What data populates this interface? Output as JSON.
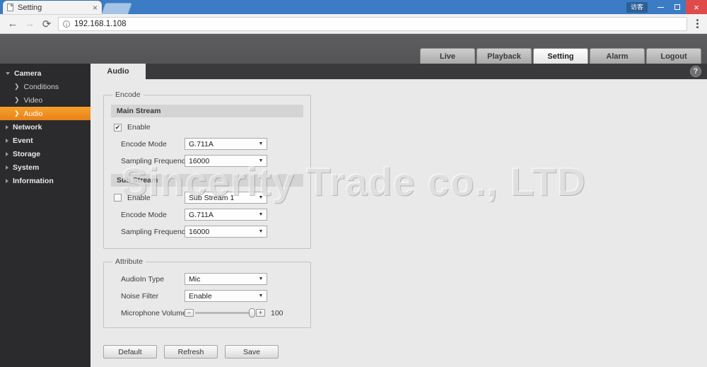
{
  "browser": {
    "tab_title": "Setting",
    "tab_close": "×",
    "back_icon": "←",
    "forward_icon": "→",
    "reload_icon": "⟳",
    "info_icon": "i",
    "url": "192.168.1.108",
    "menu_icon": "kebab-menu-icon",
    "guest_badge": "访客",
    "minimize_label": "–",
    "maximize_label": "□",
    "close_label": "×"
  },
  "app_header": {
    "brand_ghost": "",
    "nav_tabs": [
      {
        "label": "Live",
        "active": false
      },
      {
        "label": "Playback",
        "active": false
      },
      {
        "label": "Setting",
        "active": true
      },
      {
        "label": "Alarm",
        "active": false
      },
      {
        "label": "Logout",
        "active": false
      }
    ]
  },
  "sidebar": {
    "items": [
      {
        "label": "Camera",
        "level": "group",
        "expanded": true,
        "active": false
      },
      {
        "label": "Conditions",
        "level": "child",
        "active": false
      },
      {
        "label": "Video",
        "level": "child",
        "active": false
      },
      {
        "label": "Audio",
        "level": "child",
        "active": true
      },
      {
        "label": "Network",
        "level": "group",
        "expanded": false,
        "active": false
      },
      {
        "label": "Event",
        "level": "group",
        "expanded": false,
        "active": false
      },
      {
        "label": "Storage",
        "level": "group",
        "expanded": false,
        "active": false
      },
      {
        "label": "System",
        "level": "group",
        "expanded": false,
        "active": false
      },
      {
        "label": "Information",
        "level": "group",
        "expanded": false,
        "active": false
      }
    ]
  },
  "content": {
    "tab_label": "Audio",
    "help_label": "?",
    "encode": {
      "legend": "Encode",
      "main_stream": {
        "header": "Main Stream",
        "enable_label": "Enable",
        "enable_checked": true,
        "check_glyph": "✔",
        "encode_mode_label": "Encode Mode",
        "encode_mode_value": "G.711A",
        "sampling_label": "Sampling Frequency",
        "sampling_value": "16000"
      },
      "sub_stream": {
        "header": "Sub Stream",
        "enable_label": "Enable",
        "enable_checked": false,
        "check_glyph": "",
        "stream_select_value": "Sub Stream 1",
        "encode_mode_label": "Encode Mode",
        "encode_mode_value": "G.711A",
        "sampling_label": "Sampling Frequency",
        "sampling_value": "16000"
      }
    },
    "attribute": {
      "legend": "Attribute",
      "audioin_type_label": "AudioIn Type",
      "audioin_type_value": "Mic",
      "noise_filter_label": "Noise Filter",
      "noise_filter_value": "Enable",
      "mic_volume_label": "Microphone Volume",
      "mic_volume_value": "100",
      "minus_label": "−",
      "plus_label": "+"
    },
    "buttons": [
      {
        "label": "Default"
      },
      {
        "label": "Refresh"
      },
      {
        "label": "Save"
      }
    ],
    "dropdown_arrow": "▼"
  },
  "watermark": {
    "text": "Sincerity Trade co., LTD"
  },
  "colors": {
    "accent_orange": "#ee8c1e",
    "sidebar_bg": "#2b2b2d",
    "header_bg": "#5a5a5c",
    "content_bg": "#e9e9e9",
    "browser_blue": "#3b7cc4",
    "close_red": "#e04a4a"
  }
}
